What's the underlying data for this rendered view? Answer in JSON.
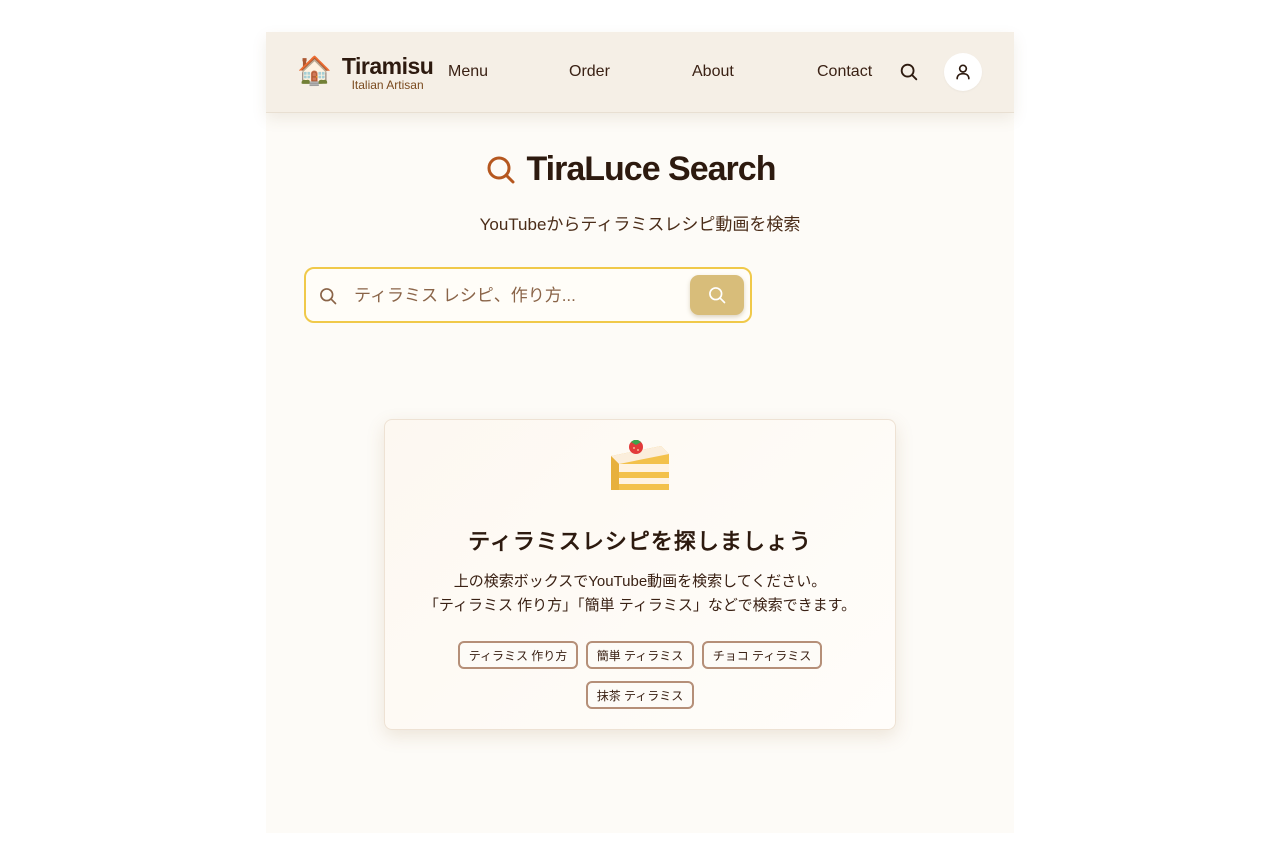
{
  "header": {
    "logo_emoji": "🏠",
    "brand_name": "Tiramisu",
    "brand_tagline": "Italian Artisan",
    "nav": [
      {
        "label": "Menu"
      },
      {
        "label": "Order"
      },
      {
        "label": "About"
      },
      {
        "label": "Contact"
      }
    ],
    "search_icon": "search-icon",
    "user_icon": "user-icon"
  },
  "main": {
    "title": "TiraLuce Search",
    "title_icon": "search-icon",
    "subtitle": "YouTubeからティラミスレシピ動画を検索",
    "search": {
      "placeholder": "ティラミス レシピ、作り方...",
      "value": ""
    }
  },
  "empty_state": {
    "icon": "shortcake-icon",
    "title": "ティラミスレシピを探しましょう",
    "description_line1": "上の検索ボックスでYouTube動画を検索してください。",
    "description_line2": "「ティラミス 作り方」「簡単 ティラミス」などで検索できます。",
    "suggestions": [
      {
        "label": "ティラミス 作り方"
      },
      {
        "label": "簡単 ティラミス"
      },
      {
        "label": "チョコ ティラミス"
      },
      {
        "label": "抹茶 ティラミス"
      }
    ]
  },
  "colors": {
    "accent": "#b5571f",
    "search_border": "#f0c94a",
    "search_button": "#d8bd7a",
    "header_bg": "#f5efe6",
    "text_dark": "#2d1a0f",
    "chip_border": "#b58f78"
  }
}
